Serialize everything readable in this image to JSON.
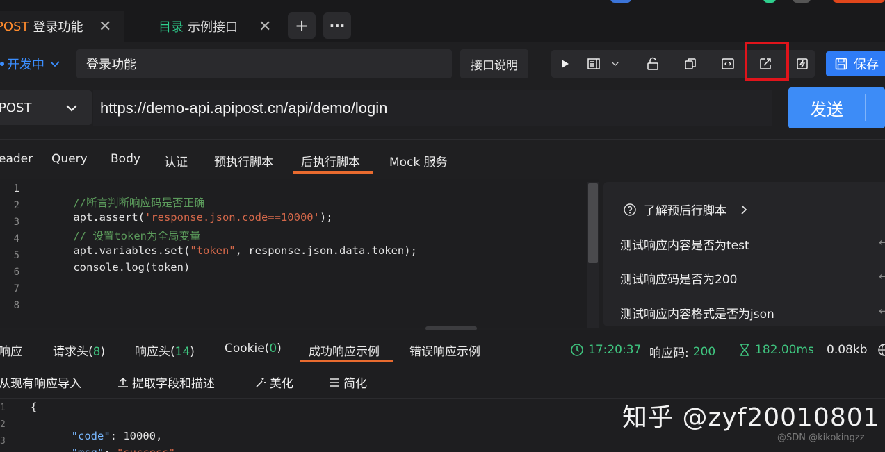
{
  "tabs": [
    {
      "method": "POST",
      "title": "登录功能",
      "close": "✕"
    },
    {
      "prefix": "目录",
      "title": "示例接口",
      "close": "✕"
    }
  ],
  "tab_actions": {
    "add": "+",
    "more": "···"
  },
  "env": {
    "label": "开发中",
    "chevron": "chevron-down-icon"
  },
  "request_name": "登录功能",
  "doc_button": "接口说明",
  "toolbar_icons": [
    "play-icon",
    "layout-icon",
    "chevron-down-icon",
    "unlock-icon",
    "copy-icon",
    "code-icon",
    "share-icon",
    "flash-icon"
  ],
  "save_button": "保存",
  "method": "POST",
  "url": "https://demo-api.apipost.cn/api/demo/login",
  "send_button": "发送",
  "request_tabs": [
    "eader",
    "Query",
    "Body",
    "认证",
    "预执行脚本",
    "后执行脚本",
    "Mock 服务"
  ],
  "active_request_tab": "后执行脚本",
  "editor": {
    "line_numbers": [
      "1",
      "2",
      "3",
      "4",
      "5",
      "6",
      "7",
      "8"
    ],
    "lines": [
      [
        {
          "t": "//断言判断响应码是否正确",
          "c": "comment"
        }
      ],
      [
        {
          "t": "apt.assert(",
          "c": "plain"
        },
        {
          "t": "'response.json.code==10000'",
          "c": "str"
        },
        {
          "t": ");",
          "c": "plain"
        }
      ],
      [
        {
          "t": "// 设置token为全局变量",
          "c": "comment"
        }
      ],
      [
        {
          "t": "apt.variables.set(",
          "c": "plain"
        },
        {
          "t": "\"token\"",
          "c": "str"
        },
        {
          "t": ", response.json.data.token);",
          "c": "plain"
        }
      ],
      [
        {
          "t": "console.log(token)",
          "c": "plain"
        }
      ]
    ]
  },
  "snippets": {
    "header": "了解预后行脚本",
    "items": [
      "测试响应内容是否为test",
      "测试响应码是否为200",
      "测试响应内容格式是否为json"
    ]
  },
  "response_tabs": {
    "t0": "响应",
    "t1_label": "请求头(",
    "t1_count": "8",
    "t1_close": ")",
    "t2_label": "响应头(",
    "t2_count": "14",
    "t2_close": ")",
    "t3_label": "Cookie(",
    "t3_count": "0",
    "t3_close": ")",
    "t4": "成功响应示例",
    "t5": "错误响应示例"
  },
  "response_meta": {
    "time": "17:20:37",
    "code_label": "响应码:",
    "code": "200",
    "duration": "182.00ms",
    "size": "0.08kb"
  },
  "response_tools": [
    "从现有响应导入",
    "提取字段和描述",
    "美化",
    "简化"
  ],
  "json_preview": {
    "line_numbers": [
      "1",
      "2",
      "3"
    ],
    "brace": "{",
    "code_key": "\"code\"",
    "code_val": "10000,",
    "msg_key": "\"msg\"",
    "msg_val": "\"success\","
  },
  "watermark": "知乎 @zyf20010801",
  "watermark_small": "@SDN @kikokingzz"
}
